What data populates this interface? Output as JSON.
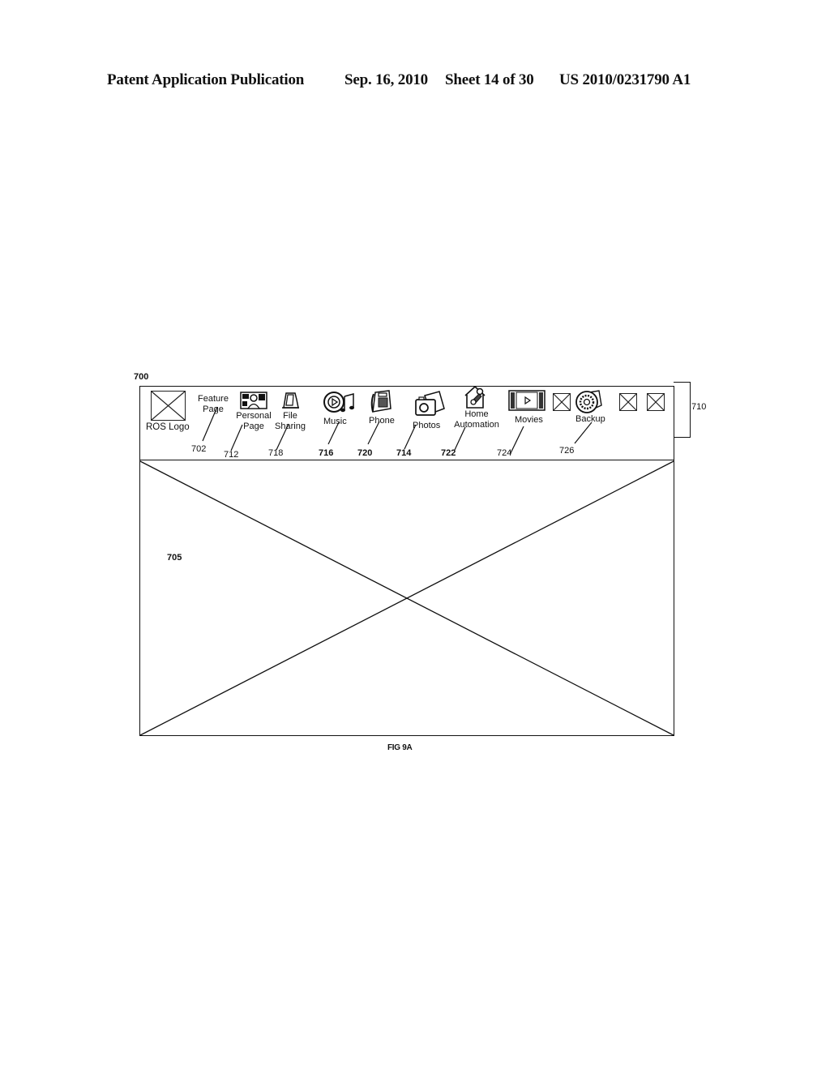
{
  "header": {
    "publication": "Patent Application Publication",
    "date": "Sep. 16, 2010",
    "sheet": "Sheet 14 of 30",
    "number": "US 2010/0231790 A1"
  },
  "figure": {
    "ref_frame": "700",
    "ref_main_area": "705",
    "ref_side_tab": "710",
    "caption": "FIG 9A",
    "logo_label": "ROS Logo",
    "nav_items": [
      {
        "label_line1": "Feature",
        "label_line2": "Page",
        "ref": "702",
        "icon": "none"
      },
      {
        "label_line1": "Personal",
        "label_line2": "Page",
        "ref": "712",
        "icon": "personal-page-icon"
      },
      {
        "label_line1": "File",
        "label_line2": "Sharing",
        "ref": "718",
        "icon": "file-sharing-icon"
      },
      {
        "label_line1": "Music",
        "label_line2": "",
        "ref": "716",
        "icon": "music-icon"
      },
      {
        "label_line1": "Phone",
        "label_line2": "",
        "ref": "720",
        "icon": "phone-icon"
      },
      {
        "label_line1": "Photos",
        "label_line2": "",
        "ref": "714",
        "icon": "photos-icon"
      },
      {
        "label_line1": "Home",
        "label_line2": "Automation",
        "ref": "722",
        "icon": "home-automation-icon"
      },
      {
        "label_line1": "Movies",
        "label_line2": "",
        "ref": "724",
        "icon": "movies-icon"
      },
      {
        "label_line1": "Backup",
        "label_line2": "",
        "ref": "726",
        "icon": "backup-icon"
      }
    ],
    "placeholder_icons": [
      "placeholder-1",
      "placeholder-2",
      "placeholder-3"
    ]
  }
}
